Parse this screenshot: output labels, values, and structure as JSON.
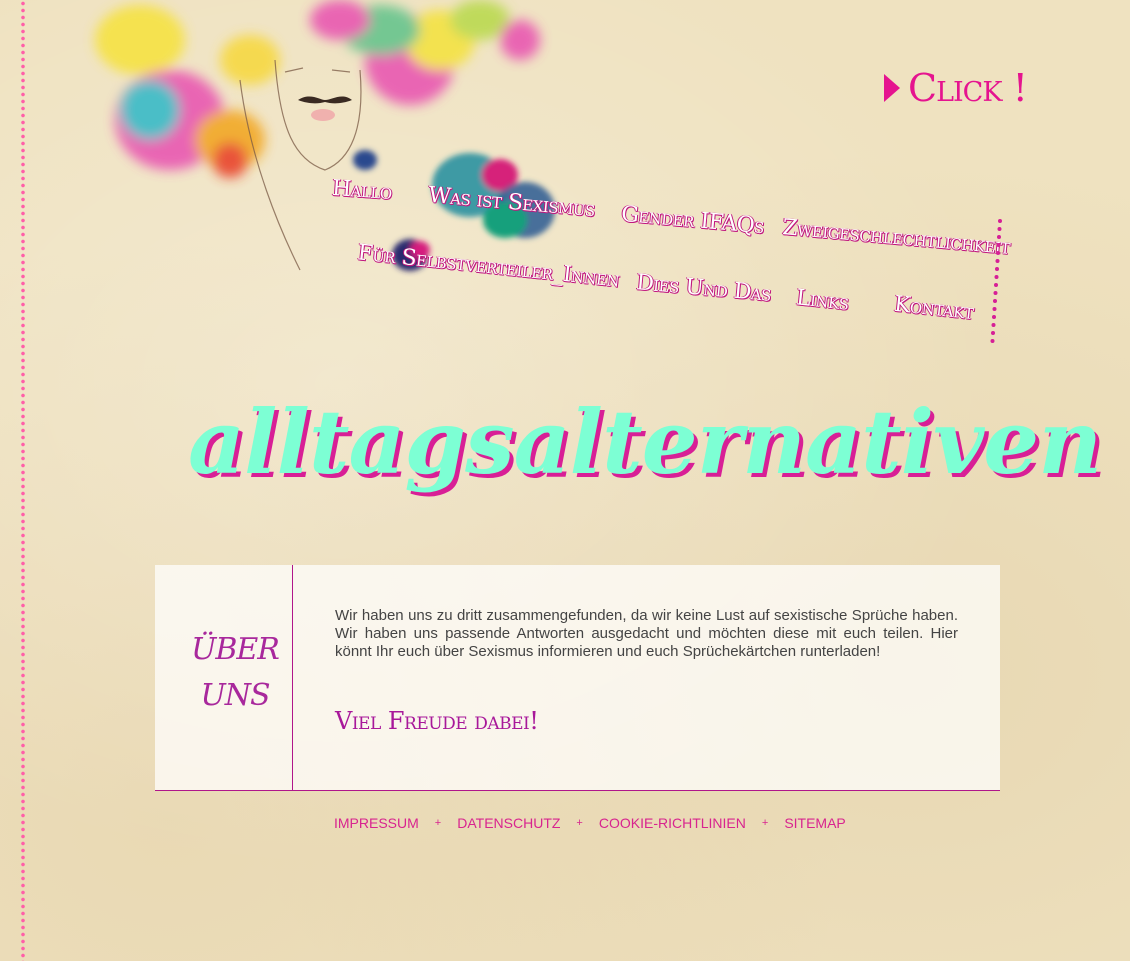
{
  "header": {
    "click_label": "Click !"
  },
  "nav": {
    "items": [
      {
        "label": "Hallo"
      },
      {
        "label": "Was ist Sexismus"
      },
      {
        "label": "Gender IFAQs"
      },
      {
        "label": "Zweigeschlechtlichkeit"
      },
      {
        "label": "Für Selbstverteiler_Innen"
      },
      {
        "label": "Dies Und Das"
      },
      {
        "label": "Links"
      },
      {
        "label": "Kontakt"
      }
    ]
  },
  "site": {
    "title": "alltagsalternativen"
  },
  "about": {
    "heading_line1": "ÜBER",
    "heading_line2": "UNS",
    "text": "Wir haben uns zu dritt zusammengefunden, da wir keine Lust auf sexistische Sprüche haben. Wir haben uns passende Antworten ausgedacht und möchten diese mit euch teilen. Hier könnt Ihr euch über Sexismus informieren und euch Sprüchekärtchen runterladen!",
    "cta": "Viel Freude dabei!"
  },
  "footer": {
    "links": [
      "IMPRESSUM",
      "DATENSCHUTZ",
      "COOKIE-RICHTLINIEN",
      "SITEMAP"
    ],
    "separator": "+"
  },
  "colors": {
    "accent_pink": "#e5148f",
    "title_mint": "#7dffd4",
    "border_purple": "#b0168a",
    "background": "#efe2c0"
  }
}
